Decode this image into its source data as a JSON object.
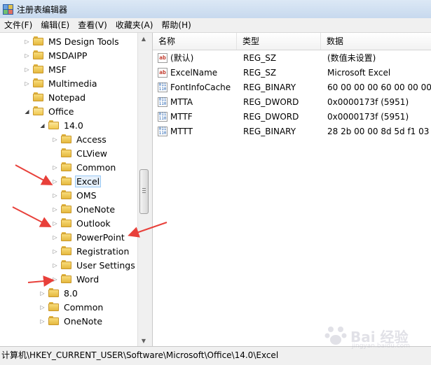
{
  "window": {
    "title": "注册表编辑器"
  },
  "menu": [
    "文件(F)",
    "编辑(E)",
    "查看(V)",
    "收藏夹(A)",
    "帮助(H)"
  ],
  "tree": [
    {
      "label": "MS Design Tools",
      "level": 0,
      "state": "collapsed"
    },
    {
      "label": "MSDAIPP",
      "level": 0,
      "state": "collapsed"
    },
    {
      "label": "MSF",
      "level": 0,
      "state": "collapsed"
    },
    {
      "label": "Multimedia",
      "level": 0,
      "state": "collapsed"
    },
    {
      "label": "Notepad",
      "level": 0,
      "state": "none"
    },
    {
      "label": "Office",
      "level": 0,
      "state": "expanded"
    },
    {
      "label": "14.0",
      "level": 1,
      "state": "expanded"
    },
    {
      "label": "Access",
      "level": 2,
      "state": "collapsed"
    },
    {
      "label": "CLView",
      "level": 2,
      "state": "none"
    },
    {
      "label": "Common",
      "level": 2,
      "state": "collapsed"
    },
    {
      "label": "Excel",
      "level": 2,
      "state": "collapsed",
      "selected": true
    },
    {
      "label": "OMS",
      "level": 2,
      "state": "collapsed"
    },
    {
      "label": "OneNote",
      "level": 2,
      "state": "collapsed"
    },
    {
      "label": "Outlook",
      "level": 2,
      "state": "collapsed"
    },
    {
      "label": "PowerPoint",
      "level": 2,
      "state": "collapsed"
    },
    {
      "label": "Registration",
      "level": 2,
      "state": "collapsed"
    },
    {
      "label": "User Settings",
      "level": 2,
      "state": "collapsed"
    },
    {
      "label": "Word",
      "level": 2,
      "state": "collapsed"
    },
    {
      "label": "8.0",
      "level": 1,
      "state": "collapsed"
    },
    {
      "label": "Common",
      "level": 1,
      "state": "collapsed"
    },
    {
      "label": "OneNote",
      "level": 1,
      "state": "collapsed"
    }
  ],
  "list": {
    "columns": [
      "名称",
      "类型",
      "数据"
    ],
    "rows": [
      {
        "icon": "string-value-icon",
        "name": "(默认)",
        "type": "REG_SZ",
        "data": "(数值未设置)"
      },
      {
        "icon": "string-value-icon",
        "name": "ExcelName",
        "type": "REG_SZ",
        "data": "Microsoft Excel"
      },
      {
        "icon": "binary-value-icon",
        "name": "FontInfoCache",
        "type": "REG_BINARY",
        "data": "60 00 00 00 60 00 00 00 f"
      },
      {
        "icon": "binary-value-icon",
        "name": "MTTA",
        "type": "REG_DWORD",
        "data": "0x0000173f (5951)"
      },
      {
        "icon": "binary-value-icon",
        "name": "MTTF",
        "type": "REG_DWORD",
        "data": "0x0000173f (5951)"
      },
      {
        "icon": "binary-value-icon",
        "name": "MTTT",
        "type": "REG_BINARY",
        "data": "28 2b 00 00 8d 5d f1 03 f"
      }
    ]
  },
  "status": {
    "path": "计算机\\HKEY_CURRENT_USER\\Software\\Microsoft\\Office\\14.0\\Excel"
  },
  "watermark": {
    "text": "Bai 经验",
    "sub": "jingyan.baidu.com"
  },
  "colors": {
    "annotation_arrow": "#e8403a",
    "selection_border": "#99c9f5"
  }
}
